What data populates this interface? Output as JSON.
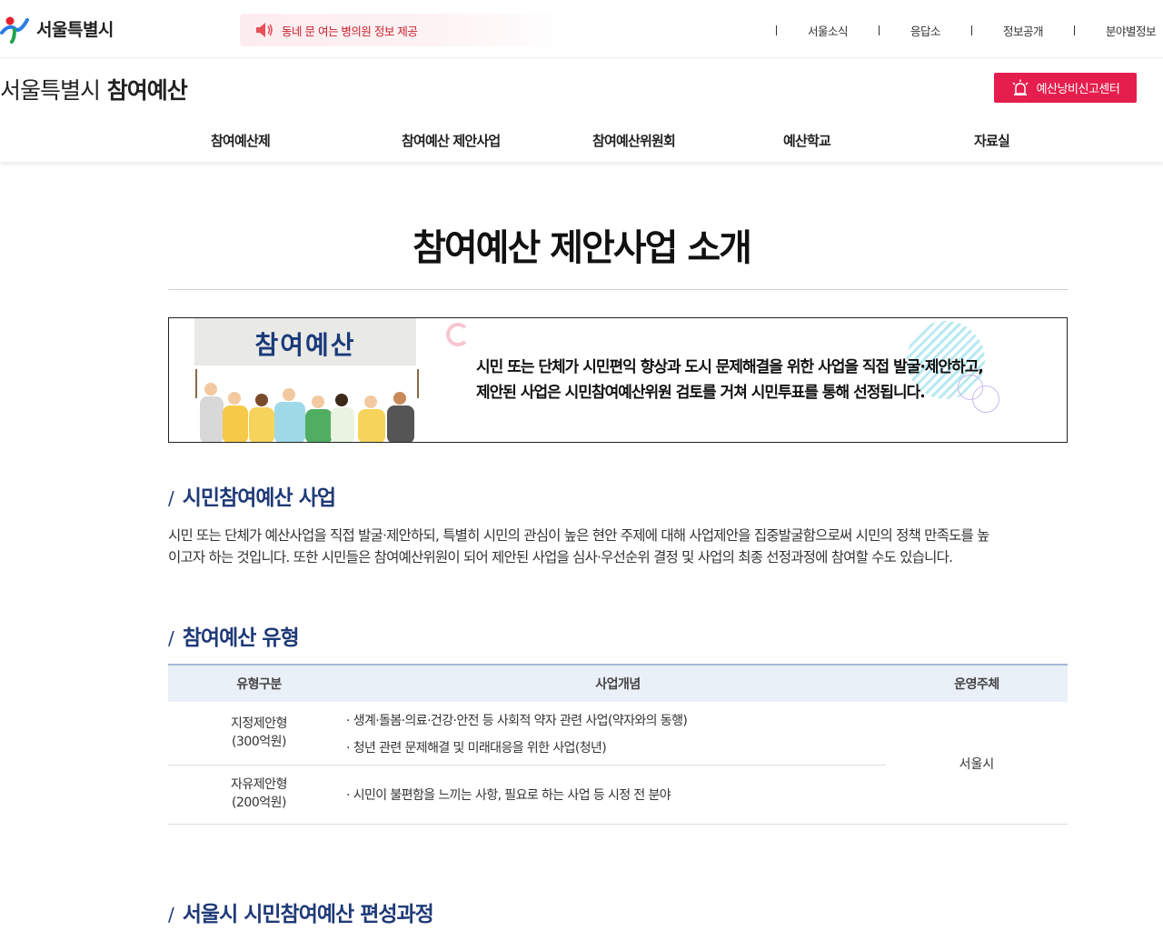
{
  "header": {
    "logo_text": "서울특별시",
    "notice_text": "동네 문 여는 병의원 정보 제공",
    "util_nav": [
      "서울소식",
      "응답소",
      "정보공개",
      "분야별정보"
    ]
  },
  "site": {
    "title_light": "서울특별시",
    "title_bold": "참여예산",
    "report_button": "예산낭비신고센터"
  },
  "nav": {
    "items": [
      "참여예산제",
      "참여예산 제안사업",
      "참여예산위원회",
      "예산학교",
      "자료실"
    ]
  },
  "page": {
    "title": "참여예산 제안사업 소개"
  },
  "intro": {
    "sign_text": "참여예산",
    "line1": "시민 또는 단체가 시민편익 향상과 도시 문제해결을 위한 사업을 직접 발굴·제안하고,",
    "line2": "제안된 사업은 시민참여예산위원 검토를 거쳐 시민투표를 통해 선정됩니다."
  },
  "sections": {
    "s1_slash": "/",
    "s1_title": "시민참여예산 사업",
    "s1_line1": "시민 또는 단체가 예산사업을 직접 발굴·제안하되, 특별히 시민의 관심이 높은 현안 주제에 대해 사업제안을 집중발굴함으로써 시민의 정책 만족도를 높",
    "s1_line2": "이고자 하는 것입니다. 또한 시민들은 참여예산위원이 되어 제안된 사업을 심사·우선순위 결정 및 사업의 최종 선정과정에 참여할 수도 있습니다.",
    "s2_title": "참여예산 유형",
    "s3_title": "서울시 시민참여예산 편성과정"
  },
  "table": {
    "headers": [
      "유형구분",
      "사업개념",
      "운영주체"
    ],
    "rows": [
      {
        "type_line1": "지정제안형",
        "type_line2": "(300억원)",
        "desc": [
          "· 생계·돌봄·의료·건강·안전 등 사회적 약자 관련 사업(약자와의 동행)",
          "· 청년 관련 문제해결 및 미래대응을 위한 사업(청년)"
        ]
      },
      {
        "type_line1": "자유제안형",
        "type_line2": "(200억원)",
        "desc": [
          "· 시민이 불편함을 느끼는 사항, 필요로 하는 사업 등 시정 전 분야"
        ]
      }
    ],
    "org": "서울시"
  },
  "colors": {
    "accent_navy": "#1f3a77",
    "report_red": "#e61e4d",
    "notice_red": "#c8202f"
  }
}
